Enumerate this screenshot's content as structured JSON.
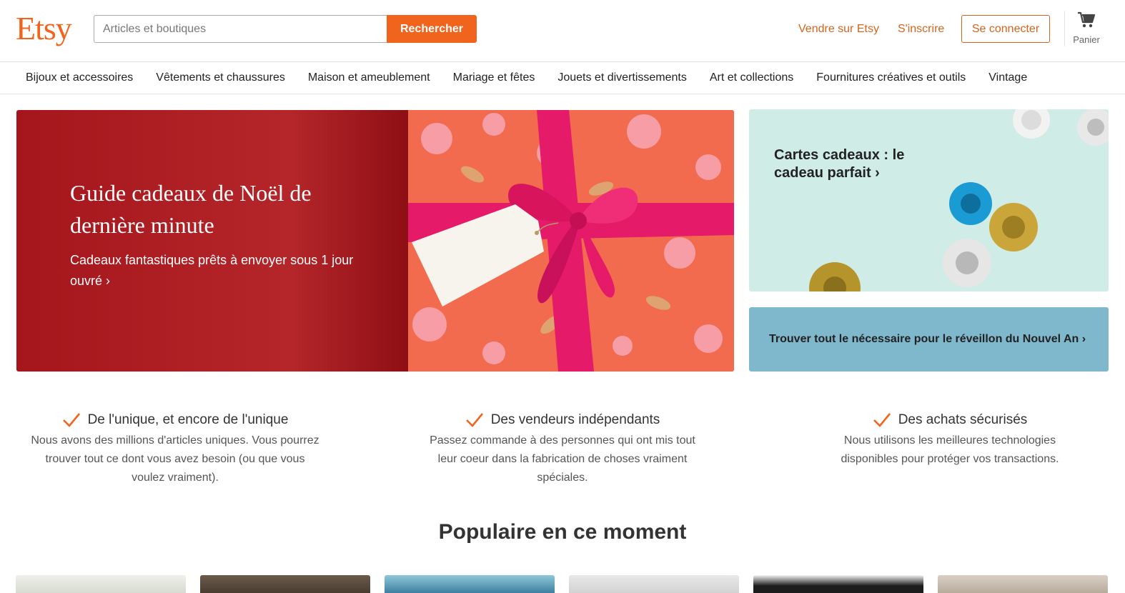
{
  "header": {
    "logo": "Etsy",
    "search": {
      "placeholder": "Articles et boutiques",
      "value": "",
      "button_label": "Rechercher"
    },
    "sell_label": "Vendre sur Etsy",
    "register_label": "S'inscrire",
    "signin_label": "Se connecter",
    "cart_label": "Panier",
    "cart_icon": "cart-icon"
  },
  "categories": [
    "Bijoux et accessoires",
    "Vêtements et chaussures",
    "Maison et ameublement",
    "Mariage et fêtes",
    "Jouets et divertissements",
    "Art et collections",
    "Fournitures créatives et outils",
    "Vintage"
  ],
  "hero": {
    "title": "Guide cadeaux de Noël de dernière minute",
    "subtitle": "Cadeaux fantastiques prêts à envoyer sous 1 jour ouvré ›"
  },
  "promos": {
    "gift_cards": "Cartes cadeaux : le cadeau parfait ›",
    "new_year": "Trouver tout le nécessaire pour le réveillon du Nouvel An ›"
  },
  "value_props": [
    {
      "title": "De l'unique, et encore de l'unique",
      "text": "Nous avons des millions d'articles uniques. Vous pourrez trouver tout ce dont vous avez besoin (ou que vous voulez vraiment)."
    },
    {
      "title": "Des vendeurs indépendants",
      "text": "Passez commande à des personnes qui ont mis tout leur coeur dans la fabrication de choses vraiment spéciales."
    },
    {
      "title": "Des achats sécurisés",
      "text": "Nous utilisons les meilleures technologies disponibles pour protéger vos transactions."
    }
  ],
  "popular_title": "Populaire en ce moment",
  "colors": {
    "accent": "#f1641e",
    "link": "#d5641c",
    "hero_red": "#a5161c",
    "ribbon": "#e51a69"
  }
}
